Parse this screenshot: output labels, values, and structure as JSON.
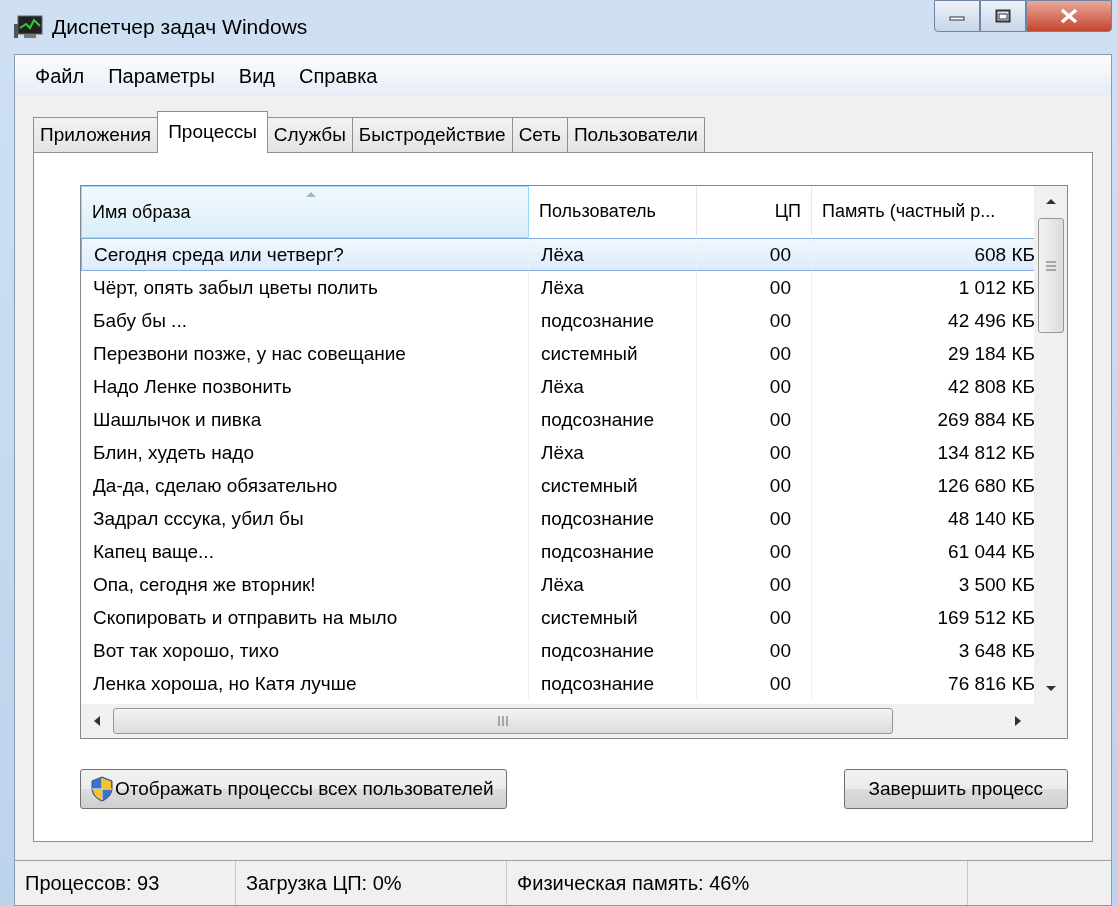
{
  "window": {
    "title": "Диспетчер задач Windows"
  },
  "menu": [
    "Файл",
    "Параметры",
    "Вид",
    "Справка"
  ],
  "tabs": [
    {
      "label": "Приложения",
      "selected": false
    },
    {
      "label": "Процессы",
      "selected": true
    },
    {
      "label": "Службы",
      "selected": false
    },
    {
      "label": "Быстродействие",
      "selected": false
    },
    {
      "label": "Сеть",
      "selected": false
    },
    {
      "label": "Пользователи",
      "selected": false
    }
  ],
  "table": {
    "columns": [
      {
        "label": "Имя образа",
        "sorted": true
      },
      {
        "label": "Пользователь",
        "sorted": false
      },
      {
        "label": "ЦП",
        "sorted": false
      },
      {
        "label": "Память (частный р...",
        "sorted": false
      }
    ],
    "rows": [
      {
        "cells": [
          "Сегодня среда или четверг?",
          "Лёха",
          "00",
          "608 КБ"
        ],
        "selected": true
      },
      {
        "cells": [
          "Чёрт, опять забыл цветы полить",
          "Лёха",
          "00",
          "1 012 КБ"
        ],
        "selected": false
      },
      {
        "cells": [
          "Бабу бы ...",
          "подсознание",
          "00",
          "42 496 КБ"
        ],
        "selected": false
      },
      {
        "cells": [
          "Перезвони позже, у нас совещание",
          "системный",
          "00",
          "29 184 КБ"
        ],
        "selected": false
      },
      {
        "cells": [
          "Надо Ленке позвонить",
          "Лёха",
          "00",
          "42 808 КБ"
        ],
        "selected": false
      },
      {
        "cells": [
          "Шашлычок и пивка",
          "подсознание",
          "00",
          "269 884 КБ"
        ],
        "selected": false
      },
      {
        "cells": [
          "Блин, худеть надо",
          "Лёха",
          "00",
          "134 812 КБ"
        ],
        "selected": false
      },
      {
        "cells": [
          "Да-да, сделаю обязательно",
          "системный",
          "00",
          "126 680 КБ"
        ],
        "selected": false
      },
      {
        "cells": [
          "Задрал сссука, убил бы",
          "подсознание",
          "00",
          "48 140 КБ"
        ],
        "selected": false
      },
      {
        "cells": [
          "Капец ваще...",
          "подсознание",
          "00",
          "61 044 КБ"
        ],
        "selected": false
      },
      {
        "cells": [
          "Опа, сегодня же вторник!",
          "Лёха",
          "00",
          "3 500 КБ"
        ],
        "selected": false
      },
      {
        "cells": [
          "Скопировать и отправить на мыло",
          "системный",
          "00",
          "169 512 КБ"
        ],
        "selected": false
      },
      {
        "cells": [
          "Вот так хорошо, тихо",
          "подсознание",
          "00",
          "3 648 КБ"
        ],
        "selected": false
      },
      {
        "cells": [
          "Ленка хороша, но Катя лучше",
          "подсознание",
          "00",
          "76 816 КБ"
        ],
        "selected": false
      }
    ]
  },
  "buttons": [
    {
      "label": "Отображать процессы всех пользователей",
      "kind": "shield"
    },
    {
      "label": "Завершить процесс",
      "kind": "plain"
    }
  ],
  "status_bar": [
    "Процессов: 93",
    "Загрузка ЦП: 0%",
    "Физическая память: 46%"
  ]
}
